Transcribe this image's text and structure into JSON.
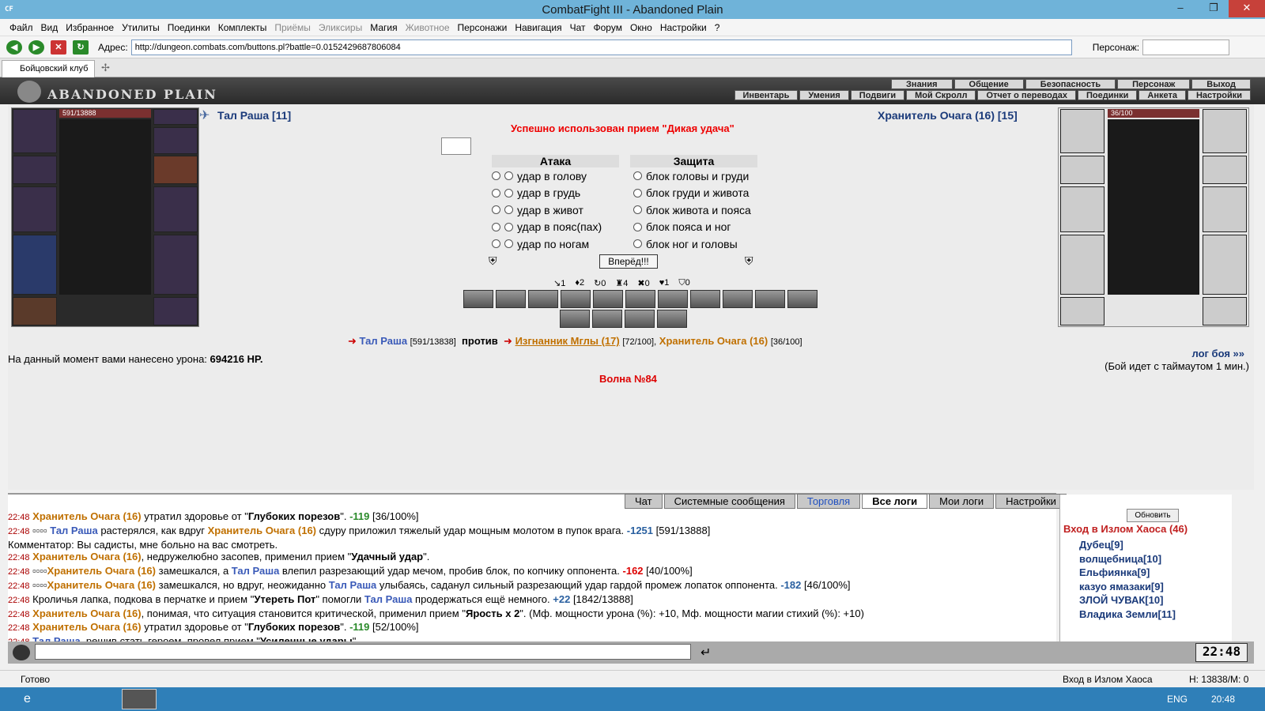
{
  "window": {
    "logo": "CF",
    "title": "CombatFight III - Abandoned Plain",
    "minimize": "–",
    "maximize": "❐",
    "close": "✕"
  },
  "menu": [
    {
      "label": "Файл",
      "dis": false
    },
    {
      "label": "Вид",
      "dis": false
    },
    {
      "label": "Избранное",
      "dis": false
    },
    {
      "label": "Утилиты",
      "dis": false
    },
    {
      "label": "Поединки",
      "dis": false
    },
    {
      "label": "Комплекты",
      "dis": false
    },
    {
      "label": "Приёмы",
      "dis": true
    },
    {
      "label": "Эликсиры",
      "dis": true
    },
    {
      "label": "Магия",
      "dis": false
    },
    {
      "label": "Животное",
      "dis": true
    },
    {
      "label": "Персонажи",
      "dis": false
    },
    {
      "label": "Навигация",
      "dis": false
    },
    {
      "label": "Чат",
      "dis": false
    },
    {
      "label": "Форум",
      "dis": false
    },
    {
      "label": "Окно",
      "dis": false
    },
    {
      "label": "Настройки",
      "dis": false
    },
    {
      "label": "?",
      "dis": false
    }
  ],
  "address": {
    "label": "Адрес:",
    "value": "http://dungeon.combats.com/buttons.pl?battle=0.0152429687806084",
    "person_label": "Персонаж:"
  },
  "tab": {
    "label": "Бойцовский клуб"
  },
  "game": {
    "logo": "ABANDONED PLAIN",
    "toplinks": [
      "Знания",
      "Общение",
      "Безопасность",
      "Персонаж",
      "Выход"
    ],
    "botlinks": [
      "Инвентарь",
      "Умения",
      "Подвиги",
      "Мой Скролл",
      "Отчет о переводах",
      "Поединки",
      "Анкета",
      "Настройки"
    ]
  },
  "player": {
    "name": "Тал Раша [11]",
    "hp": "591/13888"
  },
  "enemy": {
    "name": "Хранитель Очага (16) [15]",
    "hp": "36/100"
  },
  "battle": {
    "message": "Успешно использован прием \"Дикая удача\"",
    "attack_title": "Атака",
    "defense_title": "Защита",
    "attacks": [
      "удар в голову",
      "удар в грудь",
      "удар в живот",
      "удар в пояс(пах)",
      "удар по ногам"
    ],
    "blocks": [
      "блок головы и груди",
      "блок груди и живота",
      "блок живота и пояса",
      "блок пояса и ног",
      "блок ног и головы"
    ],
    "go": "Вперёд!!!",
    "stats": [
      "↘1",
      "♦2",
      "↻0",
      "♜4",
      "✖0",
      "♥1",
      "⛉0"
    ],
    "vs_player": "Тал Раша",
    "vs_player_hp": "[591/13838]",
    "vs_word": "против",
    "vs_enemy1": "Изгнанник Мглы (17)",
    "vs_enemy1_hp": "[72/100],",
    "vs_enemy2": "Хранитель Очага (16)",
    "vs_enemy2_hp": "[36/100]",
    "damage_label": "На данный момент вами нанесено урона:",
    "damage_value": "694216 HP.",
    "log_link": "лог боя »»",
    "timeout": "(Бой идет с таймаутом 1 мин.)",
    "wave": "Волна №84"
  },
  "chat": {
    "tabs": [
      "Чат",
      "Системные сообщения",
      "Торговля",
      "Все логи",
      "Мои логи",
      "Настройки"
    ]
  },
  "side": {
    "refresh": "Обновить",
    "title": "Вход в Излом Хаоса (46)",
    "players": [
      "Дубец[9]",
      "волщебница[10]",
      "Ельфиянка[9]",
      "казуо ямазаки[9]",
      "ЗЛОЙ ЧУВАК[10]",
      "Владика Земли[11]"
    ]
  },
  "clock": "22:48",
  "status": {
    "ready": "Готово",
    "location": "Вход в Излом Хаоса",
    "counter": "Н: 13838/М: 0"
  },
  "taskbar": {
    "lang": "ENG",
    "time": "20:48"
  }
}
